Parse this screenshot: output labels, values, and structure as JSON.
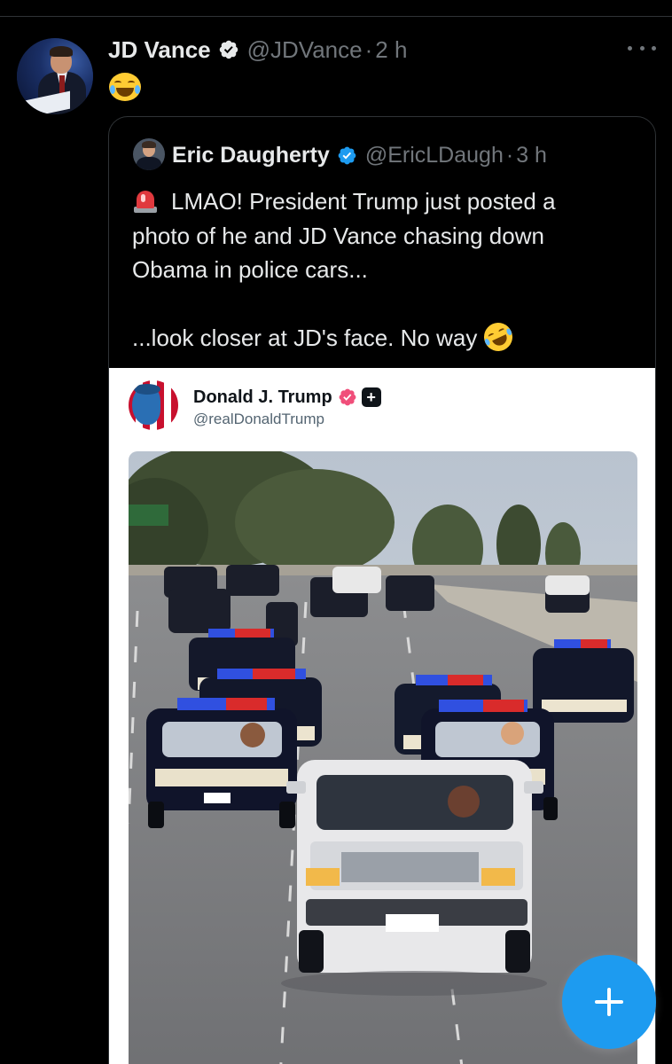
{
  "post": {
    "author_name": "JD Vance",
    "author_handle": "@JDVance",
    "separator": "·",
    "time": "2 h",
    "text_emoji": "😂"
  },
  "quoted": {
    "author_name": "Eric Daugherty",
    "author_handle": "@EricLDaugh",
    "separator": "·",
    "time": "3 h",
    "lines": [
      "LMAO! President Trump just posted a",
      "photo of he and JD Vance chasing down",
      "Obama in police cars...",
      "...look closer at JD's face. No way"
    ],
    "leading_emoji": "🚨",
    "trailing_emoji": "🤣"
  },
  "embedded": {
    "author_name": "Donald J. Trump",
    "author_handle": "@realDonaldTrump",
    "plus_badge": "+",
    "photo_icon": "police-chase-photo"
  },
  "colors": {
    "background": "#000000",
    "text": "#e7e9ea",
    "muted": "#71767b",
    "border": "#2f3336",
    "accent": "#1d9bf0",
    "trump_verified": "#f04e7a"
  },
  "icons": {
    "verified": "verified-badge-icon",
    "more": "more-dots-icon",
    "compose": "plus-icon"
  }
}
